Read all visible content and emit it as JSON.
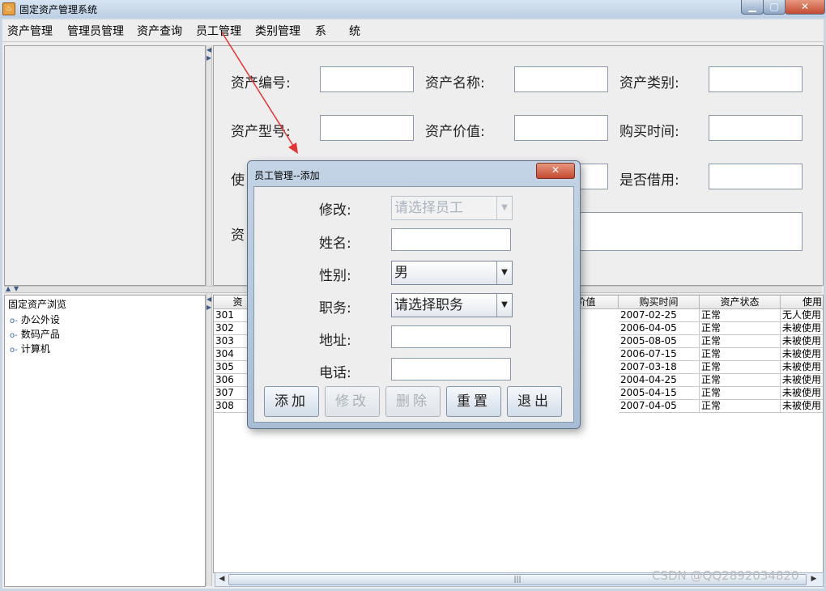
{
  "window": {
    "title": "固定资产管理系统",
    "controls": {
      "minimize": "▁",
      "maximize": "▢",
      "close": "✕"
    }
  },
  "menu": [
    "资产管理",
    "管理员管理",
    "资产查询",
    "员工管理",
    "类别管理",
    "系　　统"
  ],
  "asset_form": {
    "labels": [
      "资产编号:",
      "资产名称:",
      "资产类别:",
      "资产型号:",
      "资产价值:",
      "购买时间:",
      "使",
      "是否借用:",
      "资"
    ]
  },
  "tree": {
    "root": "固定资产浏览",
    "nodes": [
      "办公外设",
      "数码产品",
      "计算机"
    ]
  },
  "table": {
    "headers": [
      "资",
      "价值",
      "购买时间",
      "资产状态",
      "使用"
    ],
    "rows": [
      {
        "id": "301",
        "date": "2007-02-25",
        "status": "正常",
        "use": "无人使用"
      },
      {
        "id": "302",
        "date": "2006-04-05",
        "status": "正常",
        "use": "未被使用"
      },
      {
        "id": "303",
        "date": "2005-08-05",
        "status": "正常",
        "use": "未被使用"
      },
      {
        "id": "304",
        "date": "2006-07-15",
        "status": "正常",
        "use": "未被使用"
      },
      {
        "id": "305",
        "date": "2007-03-18",
        "status": "正常",
        "use": "未被使用"
      },
      {
        "id": "306",
        "date": "2004-04-25",
        "status": "正常",
        "use": "未被使用"
      },
      {
        "id": "307",
        "date": "2005-04-15",
        "status": "正常",
        "use": "未被使用"
      },
      {
        "id": "308",
        "date": "2007-04-05",
        "status": "正常",
        "use": "未被使用"
      }
    ]
  },
  "dialog": {
    "title": "员工管理--添加",
    "close": "✕",
    "labels": [
      "修改:",
      "姓名:",
      "性别:",
      "职务:",
      "地址:",
      "电话:"
    ],
    "modify_select": "请选择员工",
    "name_value": "",
    "gender_select": "男",
    "duty_select": "请选择职务",
    "address_value": "",
    "phone_value": "",
    "buttons": [
      "添加",
      "修改",
      "删除",
      "重置",
      "退出"
    ]
  },
  "watermark": "CSDN @QQ2892034820",
  "annotation_color": "#e63232",
  "scrollbar": {
    "thumb_grip": "|||"
  }
}
